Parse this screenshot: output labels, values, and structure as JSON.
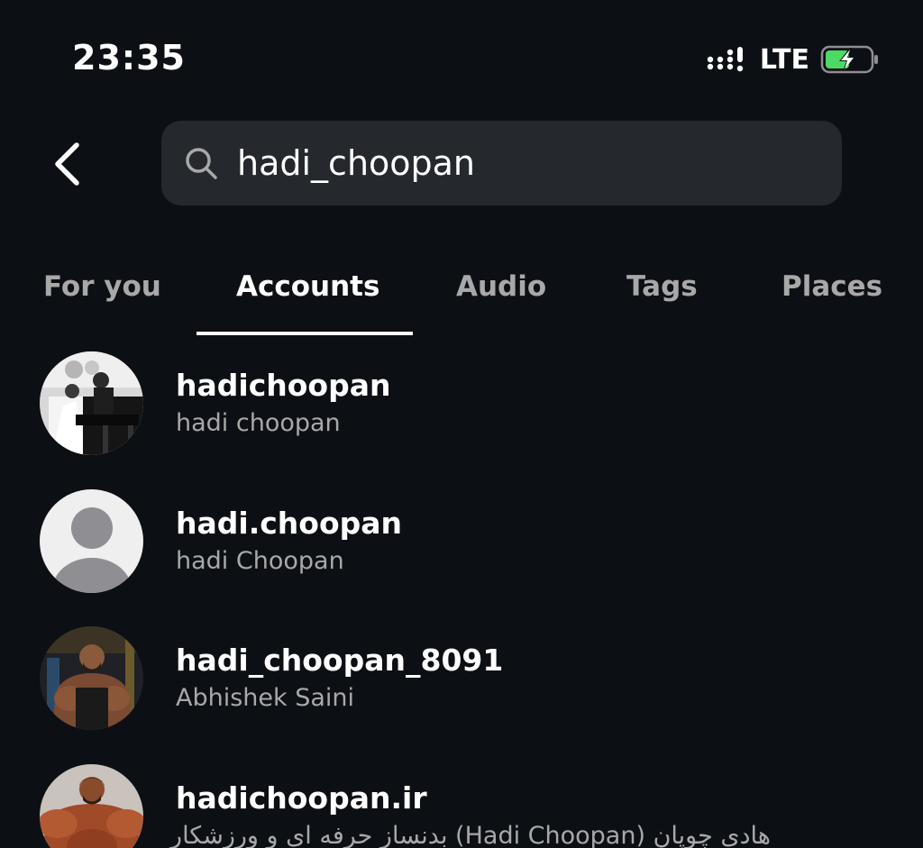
{
  "status_bar": {
    "time": "23:35",
    "network": "LTE"
  },
  "search": {
    "query": "hadi_choopan"
  },
  "tabs": [
    {
      "label": "For you",
      "active": false
    },
    {
      "label": "Accounts",
      "active": true
    },
    {
      "label": "Audio",
      "active": false
    },
    {
      "label": "Tags",
      "active": false
    },
    {
      "label": "Places",
      "active": false
    }
  ],
  "results": [
    {
      "username": "hadichoopan",
      "full_name": "hadi choopan",
      "avatar": "photo"
    },
    {
      "username": "hadi.choopan",
      "full_name": "hadi Choopan",
      "avatar": "default-avatar"
    },
    {
      "username": "hadi_choopan_8091",
      "full_name": "Abhishek Saini",
      "avatar": "photo"
    },
    {
      "username": "hadichoopan.ir",
      "full_name": "هادی چوپان (Hadi Choopan) بدنساز حرفه ای و ورزشکار",
      "avatar": "photo"
    }
  ],
  "colors": {
    "background": "#0c1014",
    "search_field": "#25292e",
    "primary_text": "#ffffff",
    "secondary_text": "#a8a8a8",
    "battery_charge": "#4cd964"
  },
  "icons": {
    "back": "chevron-left-icon",
    "search": "search-icon",
    "signal": "cellular-signal-icon",
    "battery": "battery-charging-icon"
  }
}
